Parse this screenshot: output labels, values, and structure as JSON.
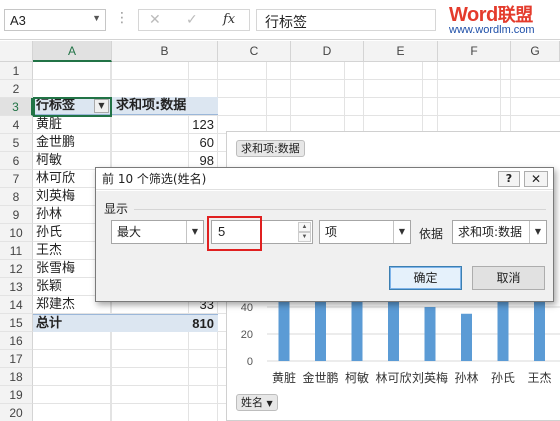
{
  "formula_bar": {
    "name_box": "A3",
    "cancel_icon": "✕",
    "enter_icon": "✓",
    "fx_label": "fx",
    "formula": "行标签"
  },
  "logo": {
    "brand": "Word",
    "brand_cn": "联盟",
    "url": "www.wordlm.com"
  },
  "columns": [
    "A",
    "B",
    "C",
    "D",
    "E",
    "F",
    "G"
  ],
  "rows": [
    "1",
    "2",
    "3",
    "4",
    "5",
    "6",
    "7",
    "8",
    "9",
    "10",
    "11",
    "12",
    "13",
    "14",
    "15",
    "16",
    "17",
    "18",
    "19",
    "20"
  ],
  "pivot": {
    "header_label": "行标签",
    "header_value": "求和项:数据",
    "items": [
      {
        "name": "黄脏",
        "value": "123"
      },
      {
        "name": "金世鹏",
        "value": "60"
      },
      {
        "name": "柯敏",
        "value": "98"
      },
      {
        "name": "林可欣",
        "value": ""
      },
      {
        "name": "刘英梅",
        "value": ""
      },
      {
        "name": "孙林",
        "value": ""
      },
      {
        "name": "孙氏",
        "value": ""
      },
      {
        "name": "王杰",
        "value": ""
      },
      {
        "name": "张雪梅",
        "value": ""
      },
      {
        "name": "张颖",
        "value": ""
      },
      {
        "name": "郑建杰",
        "value": "33"
      }
    ],
    "total_label": "总计",
    "total_value": "810"
  },
  "chart": {
    "field_button": "求和项:数据",
    "axis_button": "姓名",
    "y_ticks": [
      "40",
      "20",
      "0"
    ]
  },
  "chart_data": {
    "type": "bar",
    "categories": [
      "黄脏",
      "金世鹏",
      "柯敏",
      "林可欣",
      "刘英梅",
      "孙林",
      "孙氏",
      "王杰"
    ],
    "values": [
      123,
      60,
      98,
      48,
      40,
      35,
      70,
      100
    ],
    "ylim": [
      0,
      130
    ],
    "y_ticks_visible": [
      0,
      20,
      40
    ],
    "color": "#5b9bd5"
  },
  "dialog": {
    "title": "前 10 个筛选(姓名)",
    "help": "?",
    "close": "✕",
    "section_label": "显示",
    "direction": "最大",
    "count": "5",
    "unit": "项",
    "basis_label": "依据",
    "basis_field": "求和项:数据",
    "ok": "确定",
    "cancel": "取消"
  }
}
